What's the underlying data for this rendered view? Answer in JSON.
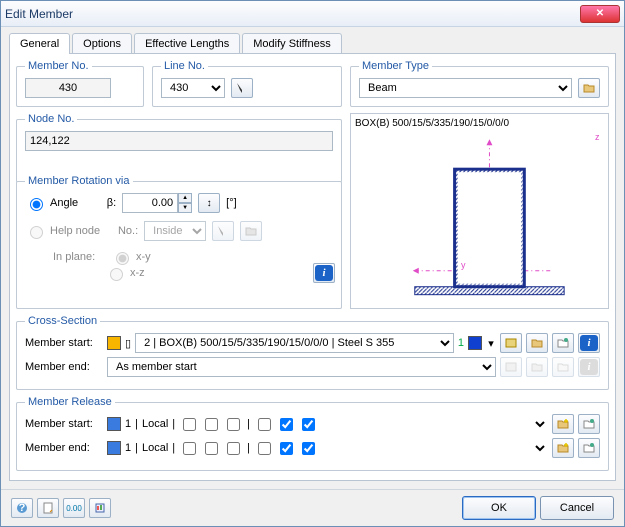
{
  "window": {
    "title": "Edit Member"
  },
  "tabs": [
    "General",
    "Options",
    "Effective Lengths",
    "Modify Stiffness"
  ],
  "member_no": {
    "legend": "Member No.",
    "value": "430"
  },
  "line_no": {
    "legend": "Line No.",
    "value": "430"
  },
  "member_type": {
    "legend": "Member Type",
    "value": "Beam"
  },
  "node_no": {
    "legend": "Node No.",
    "value": "124,122"
  },
  "rotation": {
    "legend": "Member Rotation via",
    "angle_label": "Angle",
    "beta_label": "β:",
    "beta_value": "0.00",
    "beta_unit": "[°]",
    "help_label": "Help node",
    "no_label": "No.:",
    "no_select": "Inside",
    "in_plane_label": "In plane:",
    "xy": "x-y",
    "xz": "x-z"
  },
  "preview_text": "BOX(B) 500/15/5/335/190/15/0/0/0",
  "cross_section": {
    "legend": "Cross-Section",
    "start_label": "Member start:",
    "end_label": "Member end:",
    "start_value": "2  | BOX(B) 500/15/5/335/190/15/0/0/0 | Steel S 355",
    "end_value": "As member start",
    "start_sw": "1"
  },
  "release": {
    "legend": "Member Release",
    "start_label": "Member start:",
    "end_label": "Member end:",
    "num": "1",
    "local": "Local"
  },
  "buttons": {
    "ok": "OK",
    "cancel": "Cancel"
  }
}
